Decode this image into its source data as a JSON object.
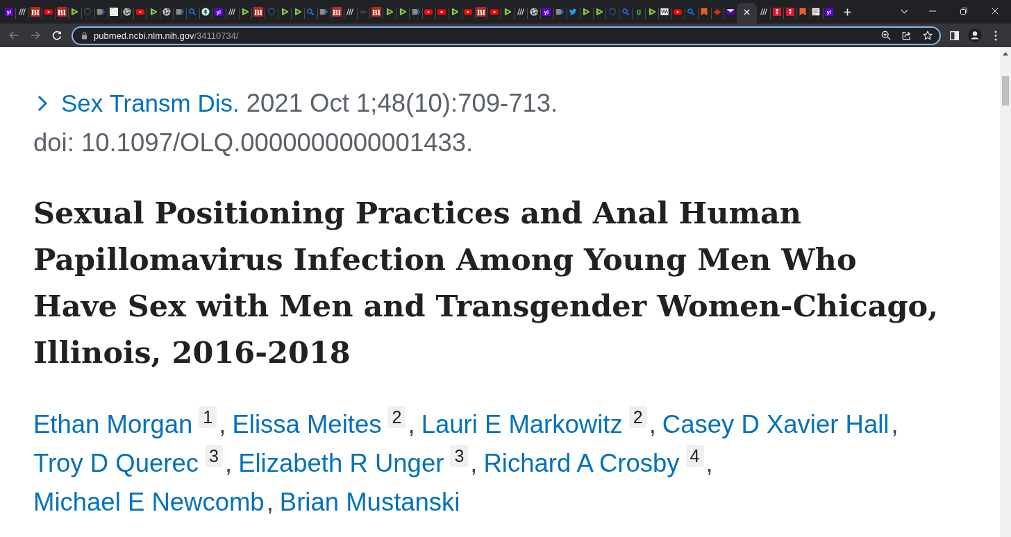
{
  "browser": {
    "tabs": [
      {
        "kind": "y",
        "glyph": "y!",
        "selected": false
      },
      {
        "kind": "slant",
        "selected": false
      },
      {
        "kind": "bi",
        "glyph": "BI",
        "selected": false
      },
      {
        "kind": "video",
        "selected": false
      },
      {
        "kind": "bi",
        "glyph": "BI",
        "selected": false
      },
      {
        "kind": "play",
        "selected": false
      },
      {
        "kind": "shield",
        "selected": false
      },
      {
        "kind": "tag",
        "selected": false
      },
      {
        "kind": "dots",
        "selected": false
      },
      {
        "kind": "globe",
        "selected": false
      },
      {
        "kind": "video",
        "selected": false
      },
      {
        "kind": "play",
        "selected": false
      },
      {
        "kind": "globe",
        "selected": false
      },
      {
        "kind": "tag",
        "selected": false
      },
      {
        "kind": "search",
        "selected": false
      },
      {
        "kind": "tree",
        "selected": false
      },
      {
        "kind": "y",
        "glyph": "y!",
        "selected": false
      },
      {
        "kind": "slant",
        "selected": false
      },
      {
        "kind": "play",
        "selected": false
      },
      {
        "kind": "bi",
        "glyph": "BI",
        "selected": false
      },
      {
        "kind": "shield",
        "selected": false
      },
      {
        "kind": "play",
        "selected": false
      },
      {
        "kind": "play",
        "selected": false
      },
      {
        "kind": "search",
        "selected": false
      },
      {
        "kind": "tag",
        "selected": false
      },
      {
        "kind": "bi",
        "glyph": "BI",
        "selected": false
      },
      {
        "kind": "slant",
        "selected": false
      },
      {
        "kind": "dark",
        "selected": false
      },
      {
        "kind": "bi",
        "glyph": "BI",
        "selected": false
      },
      {
        "kind": "play",
        "selected": false
      },
      {
        "kind": "play",
        "selected": false
      },
      {
        "kind": "tag",
        "selected": false
      },
      {
        "kind": "video",
        "selected": false
      },
      {
        "kind": "video",
        "selected": false
      },
      {
        "kind": "play",
        "selected": false
      },
      {
        "kind": "video",
        "selected": false
      },
      {
        "kind": "bi",
        "glyph": "BI",
        "selected": false
      },
      {
        "kind": "video",
        "selected": false
      },
      {
        "kind": "play",
        "selected": false
      },
      {
        "kind": "slant",
        "selected": false
      },
      {
        "kind": "globe",
        "selected": false
      },
      {
        "kind": "y",
        "glyph": "y!",
        "selected": false
      },
      {
        "kind": "tag",
        "selected": false
      },
      {
        "kind": "bird",
        "selected": false
      },
      {
        "kind": "play",
        "selected": false
      },
      {
        "kind": "play",
        "selected": false
      },
      {
        "kind": "shield",
        "selected": false
      },
      {
        "kind": "search",
        "selected": false
      },
      {
        "kind": "g",
        "glyph": "g",
        "selected": false
      },
      {
        "kind": "play",
        "selected": false
      },
      {
        "kind": "grid",
        "selected": false
      },
      {
        "kind": "video",
        "selected": false
      },
      {
        "kind": "search",
        "selected": false
      },
      {
        "kind": "ribbon",
        "selected": false
      },
      {
        "kind": "leaf",
        "selected": false
      },
      {
        "kind": "envelope",
        "selected": false
      },
      {
        "selected": true
      },
      {
        "kind": "slant",
        "selected": false
      },
      {
        "kind": "pin",
        "selected": false
      },
      {
        "kind": "pin",
        "selected": false
      },
      {
        "kind": "ribbon",
        "selected": false
      },
      {
        "kind": "doc",
        "selected": false
      },
      {
        "kind": "y",
        "glyph": "y!",
        "selected": false
      }
    ],
    "toolbar": {
      "back": {
        "disabled": true
      },
      "forward": {
        "disabled": true
      },
      "omnibox": {
        "focused": true,
        "host": "pubmed.ncbi.nlm.nih.gov",
        "path": "/34110734/"
      }
    }
  },
  "article": {
    "journal": "Sex Transm Dis.",
    "citation": "2021 Oct 1;48(10):709-713.",
    "doi": "doi: 10.1097/OLQ.0000000000001433.",
    "title": "Sexual Positioning Practices and Anal Human Papillomavirus Infection Among Young Men Who Have Sex with Men and Transgender Women-Chicago, Illinois, 2016-2018",
    "authors": [
      {
        "name": "Ethan Morgan",
        "affiliation": "1",
        "separator": ","
      },
      {
        "name": "Elissa Meites",
        "affiliation": "2",
        "separator": ","
      },
      {
        "name": "Lauri E Markowitz",
        "affiliation": "2",
        "separator": ","
      },
      {
        "name": "Casey D Xavier Hall",
        "separator": ","
      },
      {
        "name": "Troy D Querec",
        "affiliation": "3",
        "separator": ","
      },
      {
        "name": "Elizabeth R Unger",
        "affiliation": "3",
        "separator": ","
      },
      {
        "name": "Richard A Crosby",
        "affiliation": "4",
        "separator": ","
      },
      {
        "name": "Michael E Newcomb",
        "separator": ","
      },
      {
        "name": "Brian Mustanski"
      }
    ]
  }
}
